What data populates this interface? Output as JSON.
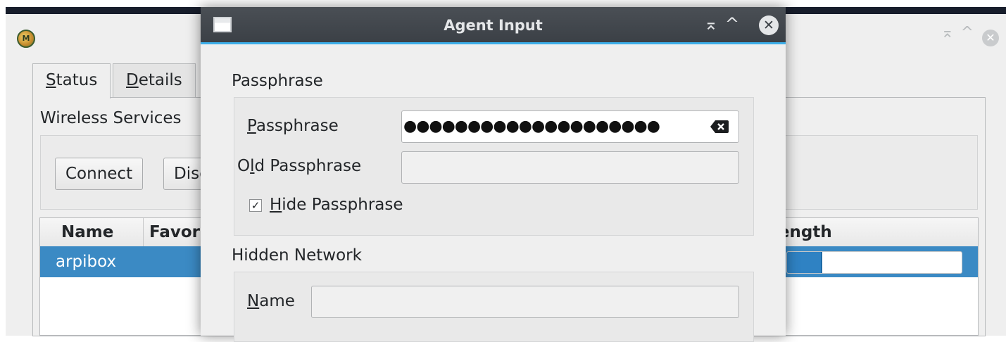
{
  "background_window": {
    "tabs": [
      {
        "prefix": "",
        "underline": "S",
        "rest": "tatus"
      },
      {
        "prefix": "",
        "underline": "D",
        "rest": "etails"
      }
    ],
    "section_title": "Wireless Services",
    "buttons": {
      "connect": "Connect",
      "disconnect": "Disconnect"
    },
    "table": {
      "headers": {
        "name": "Name",
        "favorite": "Favorite",
        "strength": "Strength"
      },
      "rows": [
        {
          "name": "arpibox",
          "strength_fraction": 0.2
        }
      ]
    },
    "controls": {
      "keep_above": "⌅",
      "maximize": "^",
      "close": "✕"
    }
  },
  "dialog": {
    "title": "Agent Input",
    "controls": {
      "keep_above": "⌅",
      "maximize": "^",
      "close": "✕"
    },
    "passphrase_group": {
      "label": "Passphrase",
      "passphrase": {
        "underline": "P",
        "rest": "assphrase",
        "masked_value": "●●●●●●●●●●●●●●●●●●●●"
      },
      "old_passphrase": {
        "prefix": "O",
        "underline": "l",
        "rest": "d Passphrase",
        "value": ""
      },
      "hide_passphrase": {
        "underline": "H",
        "rest": "ide Passphrase",
        "checked": "✓"
      }
    },
    "hidden_network_group": {
      "label": "Hidden Network",
      "name": {
        "underline": "N",
        "rest": "ame",
        "value": ""
      }
    }
  },
  "colors": {
    "accent": "#3daee9",
    "selection": "#3b8ac4",
    "titlebar": "#3b4046"
  }
}
